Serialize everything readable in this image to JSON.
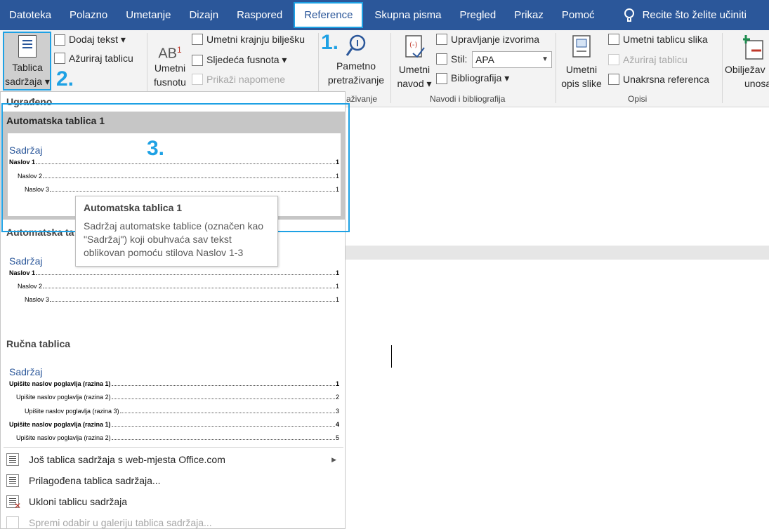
{
  "menubar": {
    "tabs": [
      "Datoteka",
      "Polazno",
      "Umetanje",
      "Dizajn",
      "Raspored",
      "Reference",
      "Skupna pisma",
      "Pregled",
      "Prikaz",
      "Pomoć"
    ],
    "active_tab": "Reference",
    "tell_me": "Recite što želite učiniti"
  },
  "ribbon": {
    "toc_button": [
      "Tablica",
      "sadržaja ▾"
    ],
    "add_text": "Dodaj tekst ▾",
    "update_table": "Ažuriraj tablicu",
    "footnote": [
      "Umetni",
      "fusnotu"
    ],
    "insert_endnote": "Umetni krajnju bilješku",
    "next_footnote": "Sljedeća fusnota  ▾",
    "show_notes": "Prikaži napomene",
    "smart_lookup": [
      "Pametno",
      "pretraživanje"
    ],
    "smart_lookup_group": "aživanje",
    "insert_citation": [
      "Umetni",
      "navod ▾"
    ],
    "manage_sources": "Upravljanje izvorima",
    "style_label": "Stil:",
    "style_value": "APA",
    "bibliography": "Bibliografija ▾",
    "citations_group": "Navodi i bibliografija",
    "insert_caption": [
      "Umetni",
      "opis slike"
    ],
    "insert_table_figures": "Umetni tablicu slika",
    "update_table_figures": "Ažuriraj tablicu",
    "cross_reference": "Unakrsna referenca",
    "captions_group": "Opisi",
    "mark_entry": [
      "Obilježav",
      "unosa"
    ],
    "step1": "1.",
    "step2": "2.",
    "footnote_icon_text": "AB",
    "footnote_icon_sup": "1"
  },
  "gallery": {
    "section_builtin": "Ugrađeno",
    "auto1": {
      "title": "Automatska tablica 1",
      "heading": "Sadržaj",
      "lines": [
        {
          "text": "Naslov 1",
          "page": "1"
        },
        {
          "text": "Naslov 2",
          "page": "1"
        },
        {
          "text": "Naslov 3",
          "page": "1"
        }
      ]
    },
    "step3": "3.",
    "auto2": {
      "title": "Automatska ta",
      "heading": "Sadržaj",
      "lines": [
        {
          "text": "Naslov 1",
          "page": "1"
        },
        {
          "text": "Naslov 2",
          "page": "1"
        },
        {
          "text": "Naslov 3",
          "page": "1"
        }
      ]
    },
    "manual": {
      "title": "Ručna tablica",
      "heading": "Sadržaj",
      "lines": [
        {
          "text": "Upišite naslov poglavlja (razina 1)",
          "page": "1"
        },
        {
          "text": "Upišite naslov poglavlja (razina 2)",
          "page": "2"
        },
        {
          "text": "Upišite naslov poglavlja (razina 3)",
          "page": "3"
        },
        {
          "text": "Upišite naslov poglavlja (razina 1)",
          "page": "4"
        },
        {
          "text": "Upišite naslov poglavlja (razina 2)",
          "page": "5"
        }
      ]
    },
    "tooltip": {
      "title": "Automatska tablica 1",
      "body": "Sadržaj automatske tablice (označen kao \"Sadržaj\") koji obuhvaća sav tekst oblikovan pomoću stilova Naslov 1-3"
    },
    "menu_items": [
      {
        "label": "Još tablica sadržaja s web-mjesta Office.com",
        "enabled": true
      },
      {
        "label": "Prilagođena tablica sadržaja...",
        "enabled": true
      },
      {
        "label": "Ukloni tablicu sadržaja",
        "enabled": true
      },
      {
        "label": "Spremi odabir u galeriju tablica sadržaja...",
        "enabled": false
      }
    ]
  }
}
